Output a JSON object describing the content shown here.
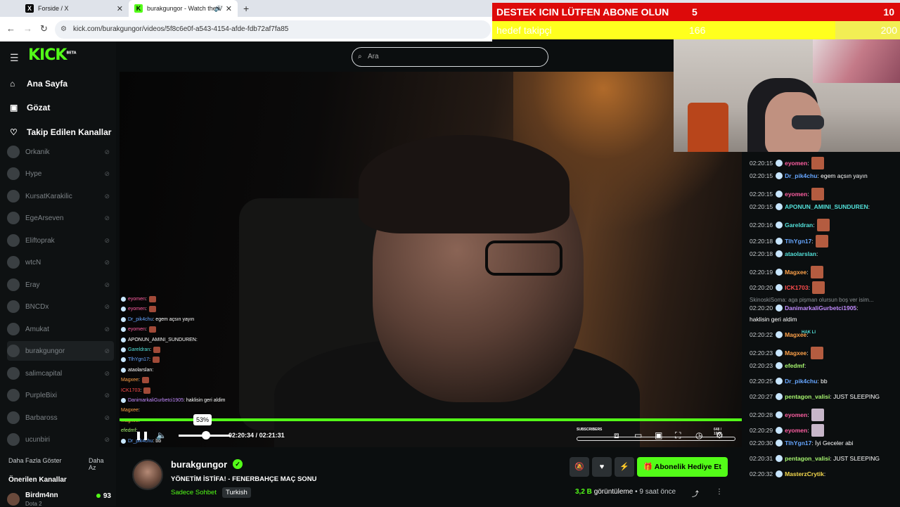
{
  "browser": {
    "tabs": [
      {
        "title": "Forside / X"
      },
      {
        "title": "burakgungor - Watch the V"
      }
    ],
    "url": "kick.com/burakgungor/videos/5f8c6e0f-a543-4154-afde-fdb72af7fa85"
  },
  "overlay": {
    "goal1": {
      "label": "DESTEK ICIN LÜTFEN ABONE OLUN",
      "current": "5",
      "target": "10"
    },
    "goal2": {
      "label": "hedef takipçi",
      "current": "166",
      "target": "200"
    }
  },
  "header": {
    "logo": "KICK",
    "logo_tag": "BETA",
    "search_placeholder": "Ara"
  },
  "sidebar": {
    "nav": [
      {
        "label": "Ana Sayfa"
      },
      {
        "label": "Gözat"
      },
      {
        "label": "Takip Edilen Kanallar"
      }
    ],
    "channels": [
      {
        "name": "Orkanik"
      },
      {
        "name": "Hype"
      },
      {
        "name": "KursatKarakilic"
      },
      {
        "name": "EgeArseven"
      },
      {
        "name": "Elif­toprak"
      },
      {
        "name": "wtcN"
      },
      {
        "name": "Eray"
      },
      {
        "name": "BNCDx"
      },
      {
        "name": "Amukat"
      },
      {
        "name": "burakgungor"
      },
      {
        "name": "salimcapital"
      },
      {
        "name": "PurpleBixi"
      },
      {
        "name": "Barbaross"
      },
      {
        "name": "ucunbiri"
      }
    ],
    "show_more": "Daha Fazla Göster",
    "show_less": "Daha Az",
    "suggested_title": "Önerilen Kanallar",
    "suggested": {
      "name": "Birdm4nn",
      "category": "Dota 2",
      "viewers": "93"
    }
  },
  "player": {
    "volume_tooltip": "53%",
    "volume_level": 0.53,
    "progress": 0.97,
    "time_current": "02:20:34",
    "time_separator": "/",
    "time_total": "02:21:31",
    "subs_label": "SUBSCRIBERS",
    "subs_count": "648 / 1907",
    "chat_overlay": [
      {
        "user": "eyomen",
        "text": ":"
      },
      {
        "user": "eyomen",
        "text": ":"
      },
      {
        "user": "Dr_pik4chu",
        "text": ": egem açsın yayın"
      },
      {
        "user": "eyomen",
        "text": ":"
      },
      {
        "user": "APONUN_AMINI_SUNDUREN",
        "text": ":"
      },
      {
        "user": "Gareldran",
        "text": ":"
      },
      {
        "user": "TlhYgn17",
        "text": ":"
      },
      {
        "user": "ataolarslan",
        "text": ":"
      },
      {
        "user": "Magxee",
        "text": ":"
      },
      {
        "user": "ICK1703",
        "text": ":"
      },
      {
        "user": "DanimarkaliGurbetci1905",
        "text": ": haklisin geri aldim"
      },
      {
        "user": "Magxee",
        "text": ":"
      },
      {
        "user": "Magxee",
        "text": ":"
      },
      {
        "user": "efedmf",
        "text": ":"
      },
      {
        "user": "Dr_pik4chu",
        "text": ": bb"
      }
    ]
  },
  "channel": {
    "name": "burakgungor",
    "video_title": "YÖNETİM İSTİFA! - FENERBAHÇE MAÇ SONU",
    "category": "Sadece Sohbet",
    "language": "Turkish",
    "subscribe_gift": "Abonelik Hediye Et",
    "views": "3,2 B",
    "views_label": "görüntüleme",
    "separator": "•",
    "ago": "9 saat önce"
  },
  "chat": {
    "messages": [
      {
        "ts": "02:20:15",
        "user": "eyomen",
        "text": ":",
        "color": "u-pink",
        "emote": true
      },
      {
        "ts": "02:20:15",
        "user": "Dr_pik4chu",
        "text": ": egem açsın yayın",
        "color": "u-blue",
        "emote": false
      },
      {
        "ts": "02:20:15",
        "user": "eyomen",
        "text": ":",
        "color": "u-pink",
        "emote": true
      },
      {
        "ts": "02:20:15",
        "user": "APONUN_AMINI_SUNDUREN",
        "text": ":",
        "color": "u-cyan",
        "emote": false
      },
      {
        "ts": "02:20:16",
        "user": "Gareldran",
        "text": ":",
        "color": "u-cyan",
        "emote": true
      },
      {
        "ts": "02:20:18",
        "user": "TlhYgn17",
        "text": ":",
        "color": "u-blue",
        "emote": true
      },
      {
        "ts": "02:20:18",
        "user": "ataolarslan",
        "text": ":",
        "color": "u-cyan",
        "emote": false
      },
      {
        "ts": "02:20:19",
        "user": "Magxee",
        "text": ":",
        "color": "u-orange",
        "emote": true
      },
      {
        "ts": "02:20:20",
        "user": "ICK1703",
        "text": ":",
        "color": "u-red",
        "emote": true
      },
      {
        "ts": "02:20:20",
        "user": "DanimarkaliGurbetci1905",
        "text": ":",
        "color": "u-purple",
        "emote": false
      },
      {
        "ts": "",
        "user": "",
        "text": "haklisin geri aldim",
        "color": "u-purple",
        "emote": false
      },
      {
        "ts": "02:20:22",
        "user": "Magxee",
        "text": ":",
        "color": "u-orange",
        "emote": false
      },
      {
        "ts": "02:20:23",
        "user": "Magxee",
        "text": ":",
        "color": "u-orange",
        "emote": true
      },
      {
        "ts": "02:20:23",
        "user": "efedmf",
        "text": ":",
        "color": "u-green",
        "emote": false
      },
      {
        "ts": "02:20:25",
        "user": "Dr_pik4chu",
        "text": ": bb",
        "color": "u-blue",
        "emote": false
      },
      {
        "ts": "02:20:27",
        "user": "pentagon_valisi",
        "text": ": JUST SLEEPING",
        "color": "u-green",
        "emote": false
      },
      {
        "ts": "02:20:28",
        "user": "eyomen",
        "text": ":",
        "color": "u-pink",
        "emote": true
      },
      {
        "ts": "02:20:29",
        "user": "eyomen",
        "text": ":",
        "color": "u-pink",
        "emote": true
      },
      {
        "ts": "02:20:30",
        "user": "TlhYgn17",
        "text": ": İyi Geceler abi",
        "color": "u-blue",
        "emote": false
      },
      {
        "ts": "02:20:31",
        "user": "pentagon_valisi",
        "text": ": JUST SLEEPING",
        "color": "u-green",
        "emote": false
      },
      {
        "ts": "02:20:32",
        "user": "MasterzCrytik",
        "text": ":",
        "color": "u-yellow",
        "emote": false
      }
    ],
    "reply_preview": "SkinoskiSoma: aga pişman olursun boş ver isim...",
    "haki_emote": "HAK LI"
  }
}
